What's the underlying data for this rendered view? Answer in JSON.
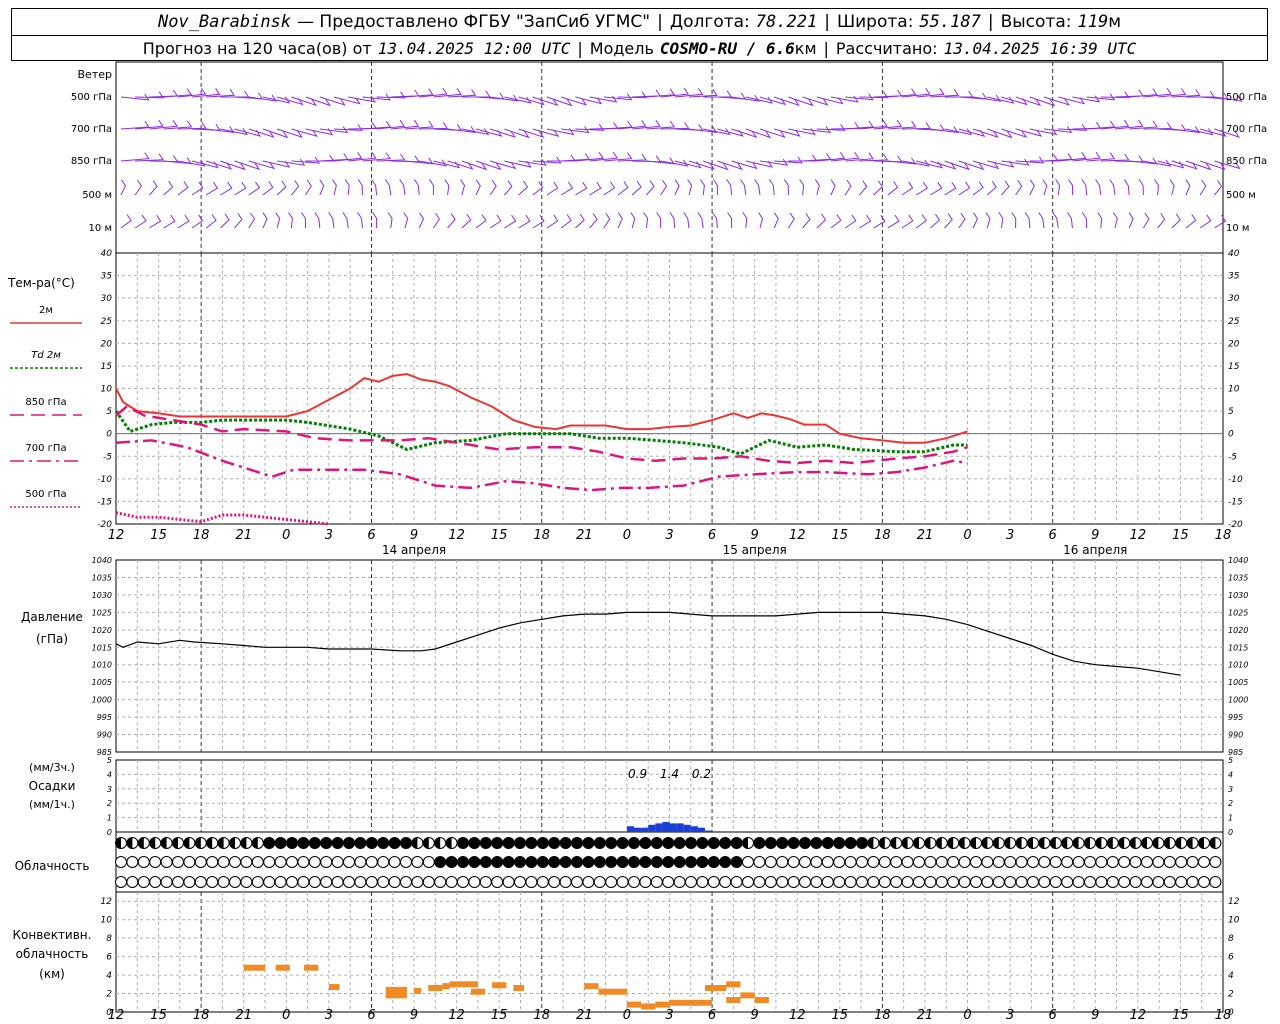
{
  "header": {
    "station": "Nov_Barabinsk",
    "provider": "— Предоставлено ФГБУ \"ЗапСиб УГМС\"",
    "lon_label": "Долгота:",
    "lon": "78.221",
    "lat_label": "Широта:",
    "lat": "55.187",
    "alt_label": "Высота:",
    "alt": "119",
    "alt_unit": "м",
    "forecast_label": "Прогноз на 120 часа(ов) от",
    "forecast_from": "13.04.2025 12:00 UTC",
    "model_label": "Модель",
    "model_name": "COSMO-RU / 6.6",
    "model_unit": "км",
    "calc_label": "Рассчитано:",
    "calc_time": "13.04.2025 16:39 UTC"
  },
  "labels": {
    "wind": "Ветер",
    "temperature": "Тем-ра(°С)",
    "pressure": "Давление",
    "pressure_unit": "(гПа)",
    "precip_3h": "(мм/3ч.)",
    "precip": "Осадки",
    "precip_1h": "(мм/1ч.)",
    "cloudiness": "Облачность",
    "conv1": "Конвективн.",
    "conv2": "облачность",
    "conv3": "(км)"
  },
  "colors": {
    "t2m": "#ee3333",
    "td2m": "#008000",
    "t850": "#e0157a",
    "t700": "#e0157a",
    "t500": "#e0157a",
    "wind": "#8a2be2",
    "precip": "#1a3fd6",
    "precip_light": "#33aa33",
    "conv": "#f08a24",
    "grid": "#b0b0b0"
  },
  "chart_data": [
    {
      "type": "wind-barbs",
      "levels": [
        "500 гПа",
        "700 гПа",
        "850 гПа",
        "500 м",
        "10 м"
      ]
    },
    {
      "type": "line",
      "title": "Тем-ра(°С)",
      "ylim": [
        -20,
        40
      ],
      "yticks": [
        40,
        35,
        30,
        25,
        20,
        15,
        10,
        5,
        0,
        -5,
        -10,
        -15,
        -20
      ],
      "x_hours_from_start": [
        0,
        3,
        6,
        9,
        12,
        15,
        18,
        21,
        24,
        27,
        30,
        33,
        36,
        39,
        42,
        45,
        48,
        51,
        54,
        57,
        60,
        63,
        66,
        69,
        72,
        75,
        78,
        81,
        84,
        87,
        90,
        93,
        96,
        99,
        102,
        105,
        108,
        111,
        114,
        117,
        120
      ],
      "x_tick_labels": [
        "12",
        "15",
        "18",
        "21",
        "0",
        "3",
        "6",
        "9",
        "12",
        "15",
        "18",
        "21",
        "0",
        "3",
        "6",
        "9",
        "12",
        "15",
        "18",
        "21",
        "0",
        "3",
        "6",
        "9",
        "12",
        "15",
        "18"
      ],
      "date_labels": [
        "14 апреля",
        "15 апреля",
        "16 апреля"
      ],
      "series": [
        {
          "name": "2м",
          "style": "solid",
          "points": [
            [
              0,
              10
            ],
            [
              1,
              7
            ],
            [
              3,
              5
            ],
            [
              6,
              4.5
            ],
            [
              9,
              3.8
            ],
            [
              12,
              3.8
            ],
            [
              15,
              3.8
            ],
            [
              18,
              3.8
            ],
            [
              21,
              3.8
            ],
            [
              24,
              3.8
            ],
            [
              27,
              5
            ],
            [
              30,
              7.5
            ],
            [
              33,
              10
            ],
            [
              35,
              12.3
            ],
            [
              37,
              11.5
            ],
            [
              39,
              12.8
            ],
            [
              41,
              13.2
            ],
            [
              43,
              12
            ],
            [
              45,
              11.5
            ],
            [
              47,
              10.5
            ],
            [
              50,
              8
            ],
            [
              53,
              6
            ],
            [
              56,
              3
            ],
            [
              59,
              1.5
            ],
            [
              62,
              1
            ],
            [
              64,
              1.8
            ],
            [
              66,
              1.8
            ],
            [
              69,
              1.8
            ],
            [
              72,
              1
            ],
            [
              75,
              1
            ],
            [
              78,
              1.5
            ],
            [
              81,
              1.8
            ],
            [
              84,
              3
            ],
            [
              87,
              4.5
            ],
            [
              89,
              3.5
            ],
            [
              91,
              4.5
            ],
            [
              93,
              4
            ],
            [
              95,
              3.2
            ],
            [
              97,
              2
            ],
            [
              100,
              2
            ],
            [
              102,
              0
            ],
            [
              105,
              -1
            ],
            [
              108,
              -1.5
            ],
            [
              111,
              -2
            ],
            [
              114,
              -2
            ],
            [
              117,
              -1
            ],
            [
              120,
              0.5
            ]
          ]
        },
        {
          "name": "Td 2м",
          "style": "dotted",
          "points": [
            [
              0,
              5
            ],
            [
              2,
              0.5
            ],
            [
              5,
              2
            ],
            [
              8,
              2.5
            ],
            [
              12,
              2.5
            ],
            [
              15,
              3
            ],
            [
              24,
              3
            ],
            [
              27,
              2.5
            ],
            [
              33,
              1
            ],
            [
              37,
              -0.5
            ],
            [
              41,
              -3.5
            ],
            [
              45,
              -2
            ],
            [
              50,
              -1.5
            ],
            [
              55,
              0
            ],
            [
              60,
              0
            ],
            [
              64,
              0
            ],
            [
              68,
              -1
            ],
            [
              72,
              -1
            ],
            [
              76,
              -1.5
            ],
            [
              80,
              -2
            ],
            [
              85,
              -3
            ],
            [
              88,
              -4.5
            ],
            [
              92,
              -1.5
            ],
            [
              96,
              -3
            ],
            [
              100,
              -2.5
            ],
            [
              104,
              -3.5
            ],
            [
              110,
              -4
            ],
            [
              114,
              -4
            ],
            [
              118,
              -2.5
            ],
            [
              120,
              -2.5
            ]
          ]
        },
        {
          "name": "850 гПа",
          "style": "dashed",
          "points": [
            [
              0,
              4
            ],
            [
              1.5,
              6
            ],
            [
              4,
              4
            ],
            [
              8,
              3
            ],
            [
              12,
              2
            ],
            [
              15,
              0.5
            ],
            [
              18,
              1
            ],
            [
              24,
              0.5
            ],
            [
              28,
              -1
            ],
            [
              33,
              -1.5
            ],
            [
              40,
              -1.5
            ],
            [
              44,
              -1
            ],
            [
              48,
              -2
            ],
            [
              54,
              -3.5
            ],
            [
              59,
              -3
            ],
            [
              64,
              -3
            ],
            [
              68,
              -4
            ],
            [
              72,
              -5.5
            ],
            [
              76,
              -6
            ],
            [
              80,
              -5.5
            ],
            [
              84,
              -5.5
            ],
            [
              88,
              -5
            ],
            [
              92,
              -6
            ],
            [
              96,
              -6.5
            ],
            [
              100,
              -6
            ],
            [
              104,
              -6.5
            ],
            [
              110,
              -5.5
            ],
            [
              114,
              -5
            ],
            [
              118,
              -4
            ],
            [
              120,
              -3
            ]
          ]
        },
        {
          "name": "700 гПа",
          "style": "dashdot",
          "points": [
            [
              0,
              -2
            ],
            [
              5,
              -1.5
            ],
            [
              10,
              -3
            ],
            [
              15,
              -6
            ],
            [
              20,
              -8.5
            ],
            [
              22,
              -9.5
            ],
            [
              25,
              -8
            ],
            [
              30,
              -8
            ],
            [
              35,
              -8
            ],
            [
              40,
              -9
            ],
            [
              45,
              -11.5
            ],
            [
              50,
              -12
            ],
            [
              55,
              -10.5
            ],
            [
              59,
              -11
            ],
            [
              63,
              -12
            ],
            [
              67,
              -12.5
            ],
            [
              71,
              -12
            ],
            [
              75,
              -12
            ],
            [
              80,
              -11.5
            ],
            [
              85,
              -9.5
            ],
            [
              90,
              -9
            ],
            [
              96,
              -8.5
            ],
            [
              100,
              -8.5
            ],
            [
              106,
              -9
            ],
            [
              110,
              -8.5
            ],
            [
              114,
              -7.5
            ],
            [
              118,
              -6
            ],
            [
              120,
              -6.5
            ]
          ]
        },
        {
          "name": "500 гПа",
          "style": "dotted-thick",
          "points": [
            [
              0,
              -17.5
            ],
            [
              3,
              -18.5
            ],
            [
              6,
              -18.5
            ],
            [
              9,
              -19
            ],
            [
              12,
              -19.5
            ],
            [
              15,
              -18
            ],
            [
              18,
              -18
            ],
            [
              21,
              -18.5
            ],
            [
              24,
              -19
            ],
            [
              27,
              -19.5
            ],
            [
              30,
              -20
            ]
          ]
        }
      ]
    },
    {
      "type": "line",
      "title": "Давление",
      "ylim": [
        985,
        1040
      ],
      "yticks": [
        1040,
        1035,
        1030,
        1025,
        1020,
        1015,
        1010,
        1005,
        1000,
        995,
        990,
        985
      ],
      "series": [
        {
          "name": "Давление",
          "points": [
            [
              0,
              1016
            ],
            [
              1,
              1015
            ],
            [
              3,
              1016.5
            ],
            [
              6,
              1016
            ],
            [
              9,
              1017
            ],
            [
              11,
              1016.5
            ],
            [
              15,
              1016
            ],
            [
              18,
              1015.5
            ],
            [
              21,
              1015
            ],
            [
              24,
              1015
            ],
            [
              27,
              1015
            ],
            [
              30,
              1014.5
            ],
            [
              33,
              1014.5
            ],
            [
              36,
              1014.5
            ],
            [
              40,
              1014
            ],
            [
              43,
              1014
            ],
            [
              45,
              1014.5
            ],
            [
              48,
              1016.5
            ],
            [
              51,
              1018.5
            ],
            [
              54,
              1020.5
            ],
            [
              57,
              1022
            ],
            [
              60,
              1023
            ],
            [
              63,
              1024
            ],
            [
              66,
              1024.5
            ],
            [
              69,
              1024.5
            ],
            [
              72,
              1025
            ],
            [
              75,
              1025
            ],
            [
              78,
              1025
            ],
            [
              81,
              1024.5
            ],
            [
              84,
              1024
            ],
            [
              87,
              1024
            ],
            [
              90,
              1024
            ],
            [
              93,
              1024
            ],
            [
              96,
              1024.5
            ],
            [
              99,
              1025
            ],
            [
              102,
              1025
            ],
            [
              105,
              1025
            ],
            [
              108,
              1025
            ],
            [
              111,
              1024.5
            ],
            [
              114,
              1024
            ],
            [
              117,
              1023
            ],
            [
              120,
              1021.5
            ],
            [
              123,
              1019.5
            ],
            [
              126,
              1017.5
            ],
            [
              129,
              1015.5
            ],
            [
              132,
              1013
            ],
            [
              135,
              1011
            ],
            [
              138,
              1010
            ],
            [
              141,
              1009.5
            ],
            [
              144,
              1009
            ],
            [
              147,
              1008
            ],
            [
              150,
              1007
            ]
          ]
        }
      ]
    },
    {
      "type": "bar",
      "title": "Осадки",
      "ylim": [
        0,
        5
      ],
      "yticks": [
        5,
        4,
        3,
        2,
        1,
        0
      ],
      "totals_3h": [
        "0.9",
        "1.4",
        "0.2"
      ],
      "bars": [
        [
          72,
          0.4
        ],
        [
          73,
          0.3
        ],
        [
          74,
          0.3
        ],
        [
          75,
          0.5
        ],
        [
          76,
          0.6
        ],
        [
          77,
          0.7
        ],
        [
          78,
          0.6
        ],
        [
          79,
          0.6
        ],
        [
          80,
          0.5
        ],
        [
          81,
          0.4
        ],
        [
          82,
          0.3
        ],
        [
          83,
          0.1
        ],
        [
          84,
          0.05
        ],
        [
          85,
          0.05
        ]
      ]
    },
    {
      "type": "symbols",
      "title": "Облачность",
      "rows": [
        "hhhhhhhhhhhhhfffffffffffffhhhhfffffffffffffffffffffffffhffffffffffhhhhhhhhhhhhhhhhhhhhhhhhhhhhhhhhhhhhhhhhhh",
        "oooooooooooooooooooooooooooofffffffffffffffffffffffffffoooooooooooooooooooooooooooooooooooooooooooooooffff",
        "oooooooooooooooooooooooooooooooooooooooooooooooooooooooooooooooooooooooooooooooooooooooooooooooooooooooooo"
      ]
    },
    {
      "type": "bar",
      "title": "Конвективн. облачность",
      "ylim": [
        0,
        13
      ],
      "yticks": [
        12,
        10,
        8,
        6,
        4,
        2,
        0
      ],
      "segments": [
        [
          18,
          21,
          4.8
        ],
        [
          22.5,
          24.5,
          4.8
        ],
        [
          26.5,
          28.5,
          4.8
        ],
        [
          30,
          31.5,
          2.7
        ],
        [
          38,
          41,
          2.4
        ],
        [
          38,
          41,
          1.8
        ],
        [
          42,
          43,
          2.3
        ],
        [
          44,
          46,
          2.6
        ],
        [
          46,
          47,
          2.8
        ],
        [
          47,
          48,
          3
        ],
        [
          48,
          51,
          3
        ],
        [
          50,
          52,
          2.2
        ],
        [
          53,
          55,
          2.9
        ],
        [
          56,
          57.5,
          2.6
        ],
        [
          66,
          68,
          2.8
        ],
        [
          68,
          72,
          2.2
        ],
        [
          72,
          74,
          0.8
        ],
        [
          74,
          76,
          0.6
        ],
        [
          76,
          78,
          0.8
        ],
        [
          78,
          82,
          1
        ],
        [
          82,
          84,
          1
        ],
        [
          83,
          86,
          2.6
        ],
        [
          86,
          88,
          3
        ],
        [
          86,
          88,
          1.3
        ],
        [
          88,
          90,
          1.8
        ],
        [
          90,
          92,
          1.3
        ]
      ]
    }
  ]
}
